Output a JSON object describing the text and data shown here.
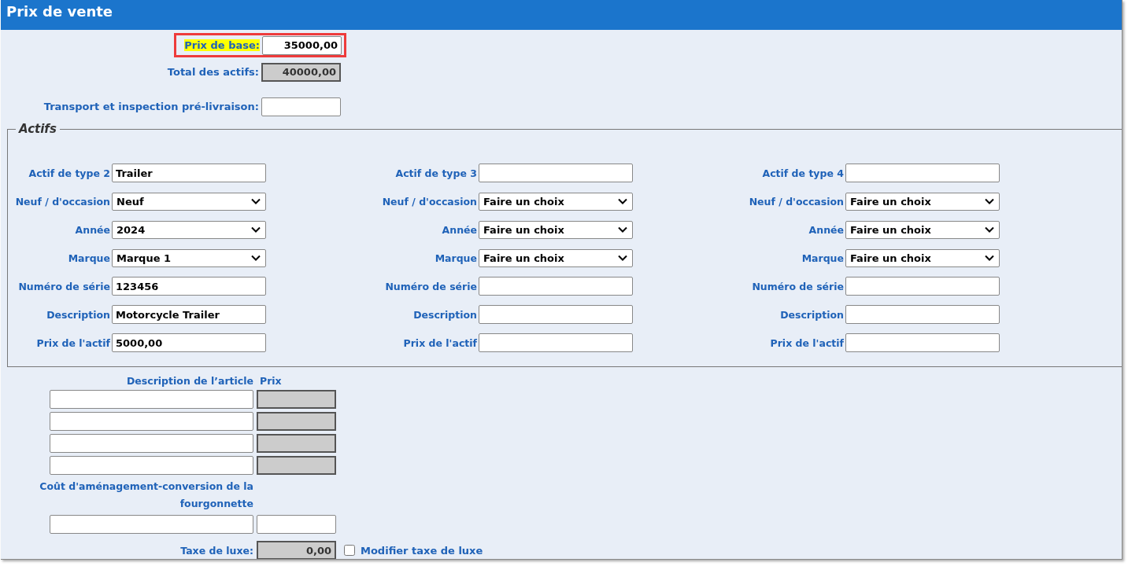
{
  "title": "Prix de vente",
  "top_fields": [
    {
      "label": "Prix de base:",
      "kind": "input",
      "value": "35000,00",
      "highlighted": true
    },
    {
      "label": "Total des actifs:",
      "kind": "readonly",
      "value": "40000,00",
      "highlighted": false
    },
    {
      "label": "Transport et inspection pré-livraison:",
      "kind": "input",
      "highlighted": false
    }
  ],
  "assets": {
    "legend": "Actifs",
    "columns": [
      {
        "fields": [
          {
            "label": "Actif de type 2",
            "kind": "text",
            "value": "Trailer"
          },
          {
            "label": "Neuf / d'occasion",
            "kind": "select",
            "value": "Neuf"
          },
          {
            "label": "Année",
            "kind": "select",
            "value": "2024"
          },
          {
            "label": "Marque",
            "kind": "select",
            "value": "Marque 1"
          },
          {
            "label": "Numéro de série",
            "kind": "text",
            "value": "123456"
          },
          {
            "label": "Description",
            "kind": "text",
            "value": "Motorcycle Trailer"
          },
          {
            "label": "Prix de l'actif",
            "kind": "text",
            "value": "5000,00"
          }
        ]
      },
      {
        "fields": [
          {
            "label": "Actif de type 3",
            "kind": "text"
          },
          {
            "label": "Neuf / d'occasion",
            "kind": "select",
            "value": "Faire un choix"
          },
          {
            "label": "Année",
            "kind": "select",
            "value": "Faire un choix"
          },
          {
            "label": "Marque",
            "kind": "select",
            "value": "Faire un choix"
          },
          {
            "label": "Numéro de série",
            "kind": "text"
          },
          {
            "label": "Description",
            "kind": "text"
          },
          {
            "label": "Prix de l'actif",
            "kind": "text"
          }
        ]
      },
      {
        "fields": [
          {
            "label": "Actif de type 4",
            "kind": "text"
          },
          {
            "label": "Neuf / d'occasion",
            "kind": "select",
            "value": "Faire un choix"
          },
          {
            "label": "Année",
            "kind": "select",
            "value": "Faire un choix"
          },
          {
            "label": "Marque",
            "kind": "select",
            "value": "Faire un choix"
          },
          {
            "label": "Numéro de série",
            "kind": "text"
          },
          {
            "label": "Description",
            "kind": "text"
          },
          {
            "label": "Prix de l'actif",
            "kind": "text"
          }
        ]
      }
    ]
  },
  "items": {
    "description_header": "Description de l’article",
    "price_header": "Prix",
    "rows": [
      {
        "price_readonly": true
      },
      {
        "price_readonly": true
      },
      {
        "price_readonly": true
      },
      {
        "price_readonly": true
      }
    ]
  },
  "conversion": {
    "label": "Coût d'aménagement-conversion de la fourgonnette",
    "price_readonly": false
  },
  "luxury_tax": {
    "label": "Taxe de luxe:",
    "value": "0,00",
    "checkbox": {
      "label": "Modifier taxe de luxe",
      "checked": false
    }
  }
}
